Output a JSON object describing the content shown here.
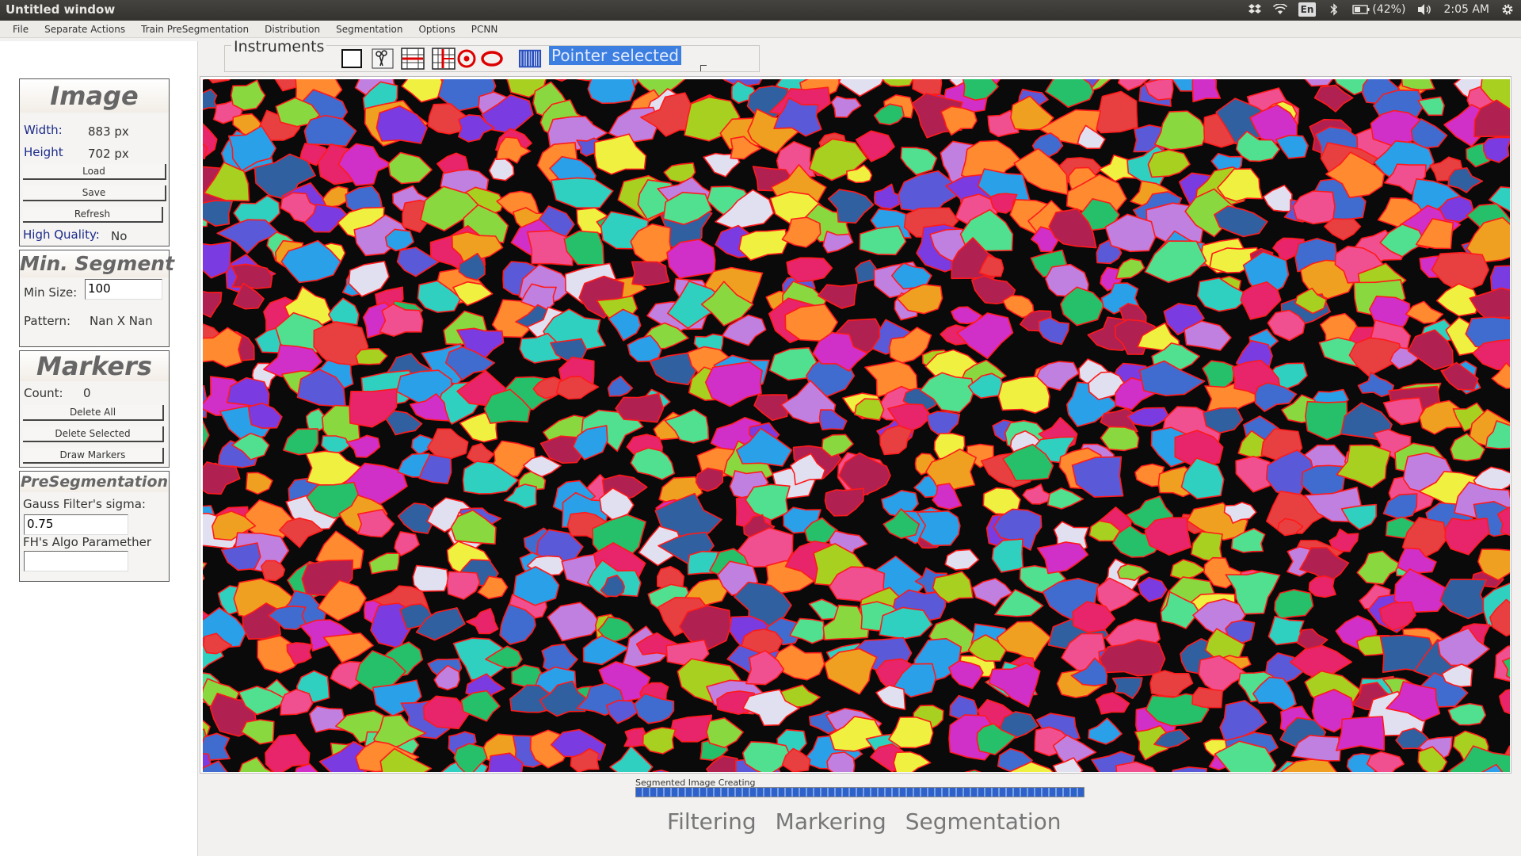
{
  "window": {
    "title": "Untitled window",
    "tray": {
      "language": "En",
      "battery": "(42%)",
      "time": "2:05 AM"
    }
  },
  "menu": [
    "File",
    "Separate Actions",
    "Train PreSegmentation",
    "Distribution",
    "Segmentation",
    "Options",
    "PCNN"
  ],
  "image_panel": {
    "title": "Image",
    "width_label": "Width:",
    "width_value": "883 px",
    "height_label": "Height",
    "height_value": "702 px",
    "load": "Load",
    "save": "Save",
    "refresh": "Refresh",
    "hq_label": "High Quality:",
    "hq_value": "No"
  },
  "min_segment": {
    "title": "Min. Segment",
    "min_size_label": "Min Size:",
    "min_size_value": "100",
    "pattern_label": "Pattern:",
    "pattern_value": "Nan X Nan"
  },
  "markers": {
    "title": "Markers",
    "count_label": "Count:",
    "count_value": "0",
    "delete_all": "Delete All",
    "delete_selected": "Delete Selected",
    "draw_markers": "Draw Markers"
  },
  "presegmentation": {
    "title": "PreSegmentation",
    "sigma_label": "Gauss Filter's sigma:",
    "sigma_value": "0.75",
    "fh_label": "FH's Algo Paramether",
    "fh_value": ""
  },
  "instruments": {
    "legend": "Instruments",
    "tools": [
      "rectangle-tool-icon",
      "scissors-tool-icon",
      "ruler-tool-icon",
      "crop-tool-icon",
      "target-tool-icon",
      "ellipse-tool-icon",
      "barcode-tool-icon"
    ],
    "status": "Pointer selected"
  },
  "progress": {
    "label": "Segmented Image Creating",
    "value": 1.0
  },
  "steps": [
    "Filtering",
    "Markering",
    "Segmentation"
  ],
  "colors": {
    "segment_palette": [
      "#e8246a",
      "#7a3be0",
      "#27c06a",
      "#f0a020",
      "#2aa0e8",
      "#d030c8",
      "#a8d020",
      "#5a5ad8",
      "#e84040",
      "#30d0c0",
      "#c080e0",
      "#f05090",
      "#406cd0",
      "#8ad840",
      "#ff8a30",
      "#e0e0f0",
      "#b02050",
      "#3060a0",
      "#50e090",
      "#f0f040"
    ],
    "segment_border": "#ff1a1a",
    "status_chip": "#3d7fe0",
    "progress": "#2f62c8"
  }
}
